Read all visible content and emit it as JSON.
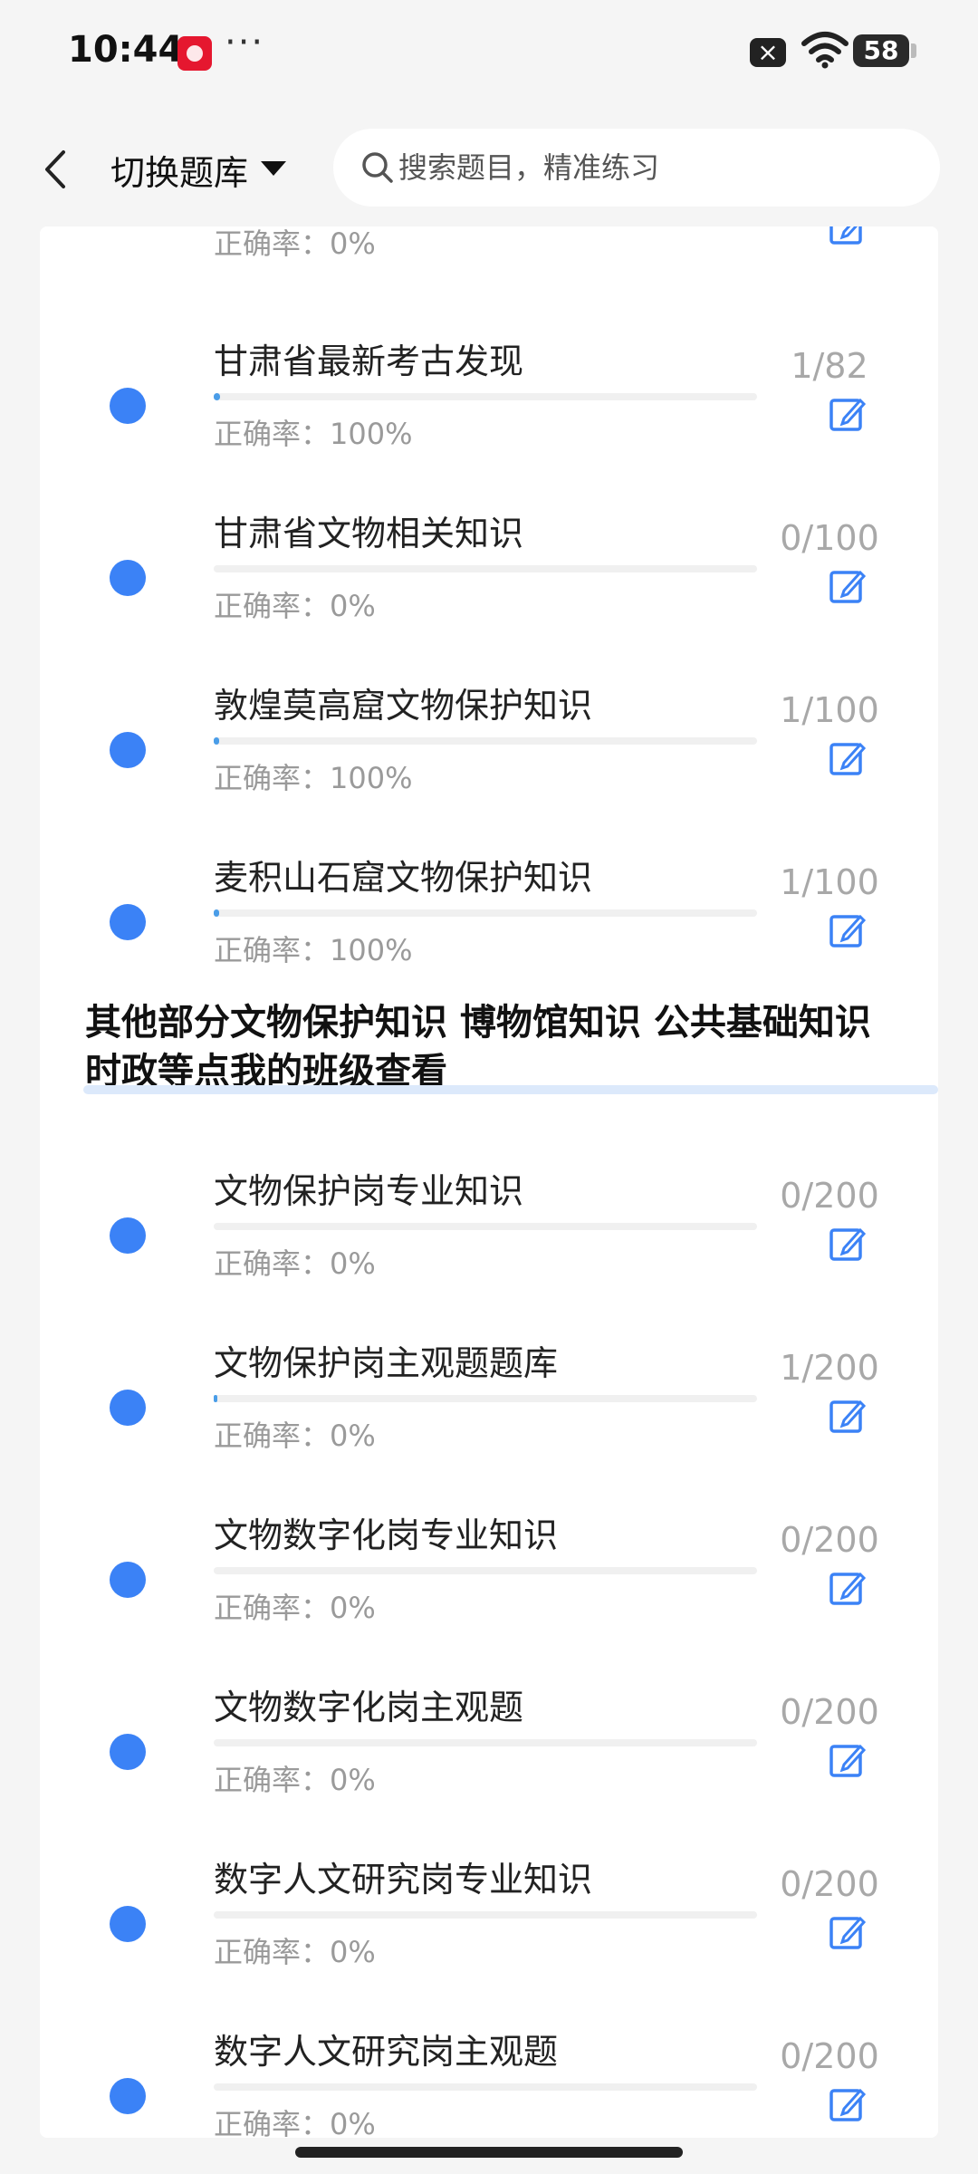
{
  "status": {
    "time": "10:44",
    "dots": "···",
    "battery": "58"
  },
  "header": {
    "switch_label": "切换题库",
    "search_placeholder": "搜索题目，精准练习"
  },
  "icons": {
    "back": "back-chevron-icon",
    "caret": "caret-down-icon",
    "search": "search-icon",
    "edit": "edit-icon"
  },
  "colors": {
    "accent": "#3b82f6",
    "progress": "#4a9de8"
  },
  "top_partial_accuracy": "正确率：0%",
  "section_title": "其他部分文物保护知识 博物馆知识 公共基础知识 时政等点我的班级查看",
  "items_group1": [
    {
      "title": "甘肃省最新考古发现",
      "count": "1/82",
      "progress": 0.012,
      "accuracy": "正确率：100%"
    },
    {
      "title": "甘肃省文物相关知识",
      "count": "0/100",
      "progress": 0,
      "accuracy": "正确率：0%"
    },
    {
      "title": "敦煌莫高窟文物保护知识",
      "count": "1/100",
      "progress": 0.01,
      "accuracy": "正确率：100%"
    },
    {
      "title": "麦积山石窟文物保护知识",
      "count": "1/100",
      "progress": 0.01,
      "accuracy": "正确率：100%"
    }
  ],
  "items_group2": [
    {
      "title": "文物保护岗专业知识",
      "count": "0/200",
      "progress": 0,
      "accuracy": "正确率：0%"
    },
    {
      "title": "文物保护岗主观题题库",
      "count": "1/200",
      "progress": 0.005,
      "accuracy": "正确率：0%"
    },
    {
      "title": "文物数字化岗专业知识",
      "count": "0/200",
      "progress": 0,
      "accuracy": "正确率：0%"
    },
    {
      "title": "文物数字化岗主观题",
      "count": "0/200",
      "progress": 0,
      "accuracy": "正确率：0%"
    },
    {
      "title": "数字人文研究岗专业知识",
      "count": "0/200",
      "progress": 0,
      "accuracy": "正确率：0%"
    },
    {
      "title": "数字人文研究岗主观题",
      "count": "0/200",
      "progress": 0,
      "accuracy": "正确率：0%"
    }
  ]
}
